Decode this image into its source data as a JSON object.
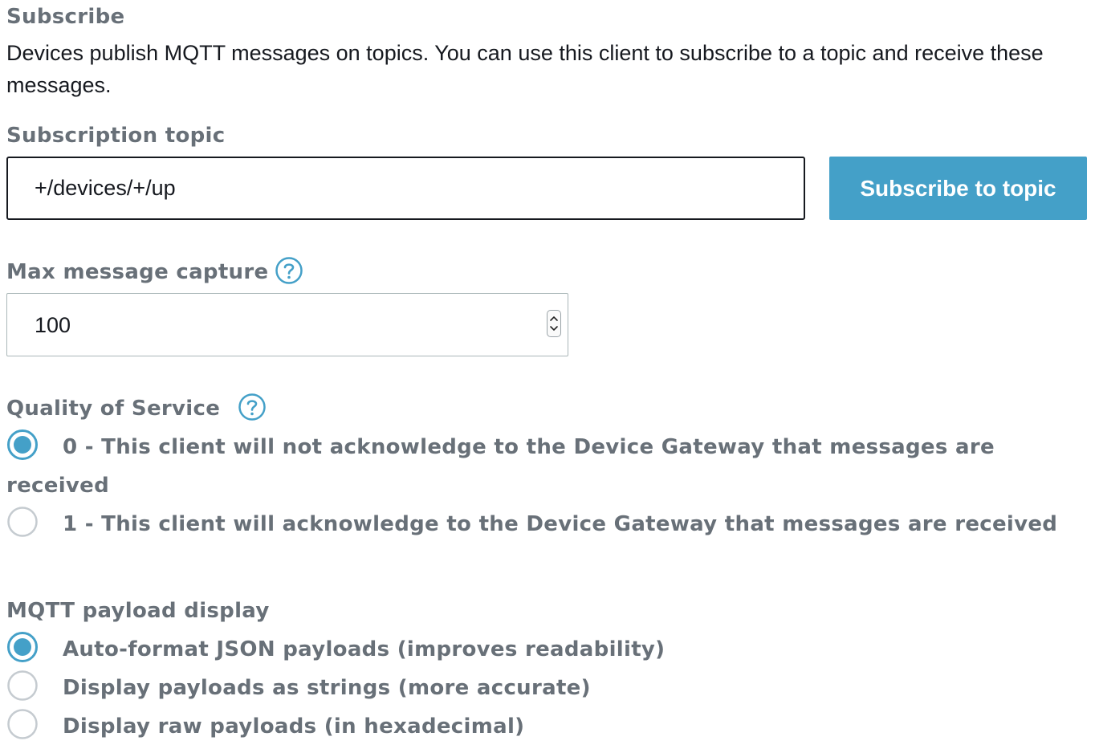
{
  "subscribe": {
    "title": "Subscribe",
    "description": "Devices publish MQTT messages on topics. You can use this client to subscribe to a topic and receive these messages.",
    "subscription_topic": {
      "label": "Subscription topic",
      "value": "+/devices/+/up"
    },
    "subscribe_button_label": "Subscribe to topic",
    "max_message_capture": {
      "label": "Max message capture",
      "value": "100",
      "help_icon": "question-circle-icon"
    },
    "qos": {
      "label": "Quality of Service",
      "help_icon": "question-circle-icon",
      "options": [
        {
          "line1": "0 - This client will not acknowledge to the Device Gateway that messages are",
          "line2": "received",
          "selected": true
        },
        {
          "label": "1 - This client will acknowledge to the Device Gateway that messages are received",
          "selected": false
        }
      ]
    },
    "payload_display": {
      "label": "MQTT payload display",
      "options": [
        {
          "label": "Auto-format JSON payloads (improves readability)",
          "selected": true
        },
        {
          "label": "Display payloads as strings (more accurate)",
          "selected": false
        },
        {
          "label": "Display raw payloads (in hexadecimal)",
          "selected": false
        }
      ]
    }
  },
  "colors": {
    "accent": "#44a0c8",
    "label_gray": "#687078",
    "text": "#16191f"
  }
}
